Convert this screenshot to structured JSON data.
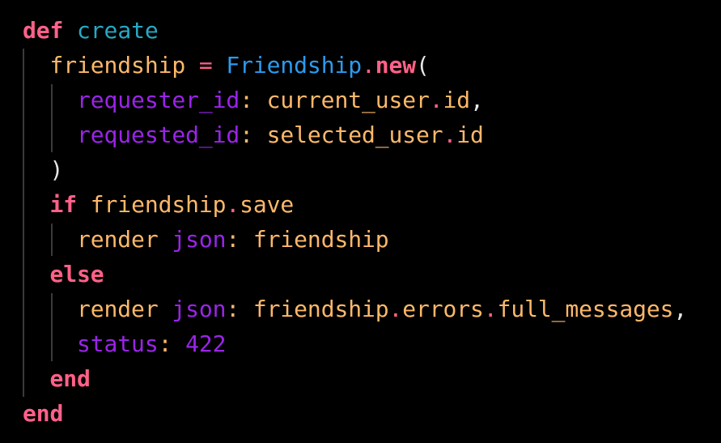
{
  "colors": {
    "background": "#000000",
    "keyword": "#ff6188",
    "method_name": "#26a9c4",
    "identifier": "#fcb86a",
    "constant": "#2b9bf0",
    "symbol_key": "#9a24e8",
    "operator": "#ff6188",
    "punctuation": "#e6e6e6",
    "number": "#9a24e8",
    "indent_guide": "#3a3a3a"
  },
  "code": {
    "lines": [
      [
        {
          "text": "def",
          "type": "keyword",
          "name": "keyword-def"
        },
        {
          "text": " ",
          "type": "space"
        },
        {
          "text": "create",
          "type": "method_name",
          "name": "method-name-create"
        }
      ],
      [
        {
          "text": "  ",
          "type": "space"
        },
        {
          "text": "friendship",
          "type": "identifier",
          "name": "variable-friendship"
        },
        {
          "text": " ",
          "type": "space"
        },
        {
          "text": "=",
          "type": "operator",
          "name": "assign-operator"
        },
        {
          "text": " ",
          "type": "space"
        },
        {
          "text": "Friendship",
          "type": "constant",
          "name": "class-friendship"
        },
        {
          "text": ".",
          "type": "operator",
          "name": "dot-operator"
        },
        {
          "text": "new",
          "type": "keyword",
          "name": "method-new"
        },
        {
          "text": "(",
          "type": "punctuation",
          "name": "open-paren"
        }
      ],
      [
        {
          "text": "    ",
          "type": "space"
        },
        {
          "text": "requester_id",
          "type": "symbol_key",
          "name": "key-requester-id"
        },
        {
          "text": ":",
          "type": "identifier",
          "name": "colon"
        },
        {
          "text": " ",
          "type": "space"
        },
        {
          "text": "current_user",
          "type": "identifier",
          "name": "identifier-current-user"
        },
        {
          "text": ".",
          "type": "operator",
          "name": "dot-operator"
        },
        {
          "text": "id",
          "type": "identifier",
          "name": "identifier-id"
        },
        {
          "text": ",",
          "type": "punctuation",
          "name": "comma"
        }
      ],
      [
        {
          "text": "    ",
          "type": "space"
        },
        {
          "text": "requested_id",
          "type": "symbol_key",
          "name": "key-requested-id"
        },
        {
          "text": ":",
          "type": "identifier",
          "name": "colon"
        },
        {
          "text": " ",
          "type": "space"
        },
        {
          "text": "selected_user",
          "type": "identifier",
          "name": "identifier-selected-user"
        },
        {
          "text": ".",
          "type": "operator",
          "name": "dot-operator"
        },
        {
          "text": "id",
          "type": "identifier",
          "name": "identifier-id"
        }
      ],
      [
        {
          "text": "  ",
          "type": "space"
        },
        {
          "text": ")",
          "type": "punctuation",
          "name": "close-paren"
        }
      ],
      [
        {
          "text": "  ",
          "type": "space"
        },
        {
          "text": "if",
          "type": "keyword",
          "name": "keyword-if"
        },
        {
          "text": " ",
          "type": "space"
        },
        {
          "text": "friendship",
          "type": "identifier",
          "name": "identifier-friendship"
        },
        {
          "text": ".",
          "type": "operator",
          "name": "dot-operator"
        },
        {
          "text": "save",
          "type": "identifier",
          "name": "identifier-save"
        }
      ],
      [
        {
          "text": "    ",
          "type": "space"
        },
        {
          "text": "render",
          "type": "identifier",
          "name": "identifier-render"
        },
        {
          "text": " ",
          "type": "space"
        },
        {
          "text": "json",
          "type": "symbol_key",
          "name": "key-json"
        },
        {
          "text": ":",
          "type": "identifier",
          "name": "colon"
        },
        {
          "text": " ",
          "type": "space"
        },
        {
          "text": "friendship",
          "type": "identifier",
          "name": "identifier-friendship"
        }
      ],
      [
        {
          "text": "  ",
          "type": "space"
        },
        {
          "text": "else",
          "type": "keyword",
          "name": "keyword-else"
        }
      ],
      [
        {
          "text": "    ",
          "type": "space"
        },
        {
          "text": "render",
          "type": "identifier",
          "name": "identifier-render"
        },
        {
          "text": " ",
          "type": "space"
        },
        {
          "text": "json",
          "type": "symbol_key",
          "name": "key-json"
        },
        {
          "text": ":",
          "type": "identifier",
          "name": "colon"
        },
        {
          "text": " ",
          "type": "space"
        },
        {
          "text": "friendship",
          "type": "identifier",
          "name": "identifier-friendship"
        },
        {
          "text": ".",
          "type": "operator",
          "name": "dot-operator"
        },
        {
          "text": "errors",
          "type": "identifier",
          "name": "identifier-errors"
        },
        {
          "text": ".",
          "type": "operator",
          "name": "dot-operator"
        },
        {
          "text": "full_messages",
          "type": "identifier",
          "name": "identifier-full-messages"
        },
        {
          "text": ",",
          "type": "punctuation",
          "name": "comma"
        }
      ],
      [
        {
          "text": "    ",
          "type": "space"
        },
        {
          "text": "status",
          "type": "symbol_key",
          "name": "key-status"
        },
        {
          "text": ":",
          "type": "identifier",
          "name": "colon"
        },
        {
          "text": " ",
          "type": "space"
        },
        {
          "text": "422",
          "type": "number",
          "name": "number-422"
        }
      ],
      [
        {
          "text": "  ",
          "type": "space"
        },
        {
          "text": "end",
          "type": "keyword",
          "name": "keyword-end"
        }
      ],
      [
        {
          "text": "end",
          "type": "keyword",
          "name": "keyword-end"
        }
      ]
    ]
  }
}
